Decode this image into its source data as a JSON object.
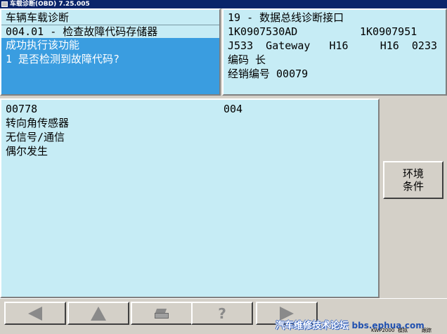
{
  "window": {
    "title": "车载诊断(OBD) 7.25.005"
  },
  "top_left": {
    "line1": "车辆车载诊断",
    "line2": "004.01 - 检查故障代码存储器",
    "selected_line1": "成功执行该功能",
    "selected_line2": "1 是否检测到故障代码?"
  },
  "top_right": {
    "line1": "19 - 数据总线诊断接口",
    "part_no_left": "1K0907530AD",
    "part_no_right": "1K0907951",
    "component": "J533  Gateway   H16     H16  0233",
    "coding": "编码 长",
    "dealer": "经销编号 00079"
  },
  "main": {
    "code": "00778",
    "count": "004",
    "desc1": "转向角传感器",
    "desc2": "无信号/通信",
    "desc3": "偶尔发生"
  },
  "side": {
    "env_button_line1": "环境",
    "env_button_line2": "条件"
  },
  "toolbar": {
    "back_icon": "arrow-left-icon",
    "up_icon": "arrow-up-icon",
    "print_icon": "printer-icon",
    "help_label": "?",
    "next_icon": "arrow-right-icon"
  },
  "status": {
    "kwp": "KWP2000",
    "mode1": "模拟",
    "mode2": "跟踪"
  },
  "watermark": {
    "text": "汽车维修技术论坛",
    "url": "bbs.ephua.com"
  }
}
